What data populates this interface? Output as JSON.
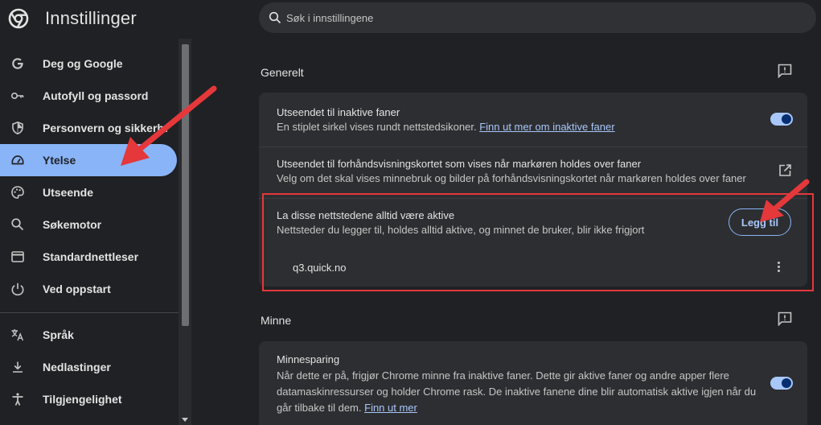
{
  "header": {
    "title": "Innstillinger",
    "search_placeholder": "Søk i innstillingene"
  },
  "sidebar": {
    "items": [
      {
        "label": "Deg og Google",
        "icon": "google-g-icon"
      },
      {
        "label": "Autofyll og passord",
        "icon": "key-icon"
      },
      {
        "label": "Personvern og sikkerhet",
        "icon": "shield-icon"
      },
      {
        "label": "Ytelse",
        "icon": "speedometer-icon",
        "active": true
      },
      {
        "label": "Utseende",
        "icon": "palette-icon"
      },
      {
        "label": "Søkemotor",
        "icon": "search-icon"
      },
      {
        "label": "Standardnettleser",
        "icon": "browser-window-icon"
      },
      {
        "label": "Ved oppstart",
        "icon": "power-icon"
      },
      {
        "label": "Språk",
        "icon": "translate-icon"
      },
      {
        "label": "Nedlastinger",
        "icon": "download-icon"
      },
      {
        "label": "Tilgjengelighet",
        "icon": "accessibility-icon"
      }
    ]
  },
  "general": {
    "title": "Generelt",
    "inactive_tabs": {
      "title": "Utseendet til inaktive faner",
      "desc": "En stiplet sirkel vises rundt nettstedsikoner.",
      "link": "Finn ut mer om inaktive faner",
      "enabled": true
    },
    "hover_card": {
      "title": "Utseendet til forhåndsvisningskortet som vises når markøren holdes over faner",
      "desc": "Velg om det skal vises minnebruk og bilder på forhåndsvisningskortet når markøren holdes over faner"
    },
    "always_active": {
      "title": "La disse nettstedene alltid være aktive",
      "desc": "Nettsteder du legger til, holdes alltid aktive, og minnet de bruker, blir ikke frigjort",
      "add_label": "Legg til",
      "sites": [
        "q3.quick.no"
      ]
    }
  },
  "memory": {
    "title": "Minne",
    "saver": {
      "title": "Minnesparing",
      "desc": "Når dette er på, frigjør Chrome minne fra inaktive faner. Dette gir aktive faner og andre apper flere datamaskinressurser og holder Chrome rask. De inaktive fanene dine blir automatisk aktive igjen når du går tilbake til dem.",
      "link": "Finn ut mer",
      "enabled": true
    }
  },
  "colors": {
    "accent": "#8ab4f8",
    "annotation_red": "#e5383b"
  }
}
